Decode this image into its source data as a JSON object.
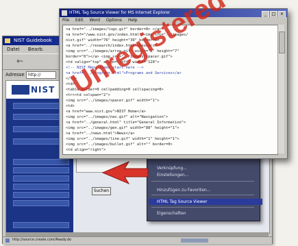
{
  "back_window": {
    "title": "NIST Guidebook",
    "menu": [
      "Datei",
      "Bearb."
    ],
    "address_label": "Adresse",
    "address_value": "http://",
    "nist_text": "NIST",
    "go_button": "Suchen",
    "status_text": "http://source.create.com/Ready.do"
  },
  "context_menu": {
    "items": [
      "Verknüpfung...",
      "Einstellungen...",
      "Hinzufügen zu Favoriten...",
      "HTML Tag Source Viewer",
      "Eigenschaften"
    ],
    "highlighted_index": 3
  },
  "front_window": {
    "title": "HTML Tag Source Viewer for MS Internet Explorer",
    "menu": [
      "File",
      "Edit",
      "Word",
      "Options",
      "Help"
    ],
    "code_lines": [
      "<a href=\"../images/logo.gif\" border=0> </a>",
      "<a href=\"/www.nist.gov/index.html\"><img src=\"../images/",
      "  nist.gif\" width=\"76\" height=\"39\" border=0>",
      "<a href=\"../research/index.html\">Research",
      "<img src=\"../images/arrow.gif\" width=\"8\" height=\"7\"",
      "  border=\"0\"></a> <img src=\"../images/spacer.gif\">",
      "<td valign=\"top\" align=\"left\" width=\"120\">",
      "<!-- NIST Menu Items start here -->",
      "<a href=\"../programs.html\">Programs and Services</a>",
      "</td>",
      "<td>",
      "<table border=0 cellpadding=0 cellspacing=0>",
      "<tr><td colspan=\"2\">",
      "<img src=\"../images/spacer.gif\" width=\"1\">",
      "<td>",
      "<a href=\"www.nist.gov\">NIST Home</a>",
      "<img src=\"../images/nav.gif\" alt=\"Navigation\">",
      "<a href=\"../general.html\" title=\"General Information\">",
      "  <img src=\"../images/gen.gif\" width=\"88\" height=\"1\">",
      "<a href=\"../news.html\">News</a>",
      "<img src=\"../images/line.gif\" width=\"1\" height=\"1\">",
      "<img src=\"../images/bullet.gif\" alt=\"\" border=0>",
      "<td align=\"right\">"
    ],
    "blue_lines": [
      7,
      8
    ]
  },
  "watermark": "Unregistered",
  "colors": {
    "watermark": "#d22618",
    "titlebar": "#0a1a7a",
    "nav": "#1b3486",
    "arrow": "#d9332a"
  }
}
